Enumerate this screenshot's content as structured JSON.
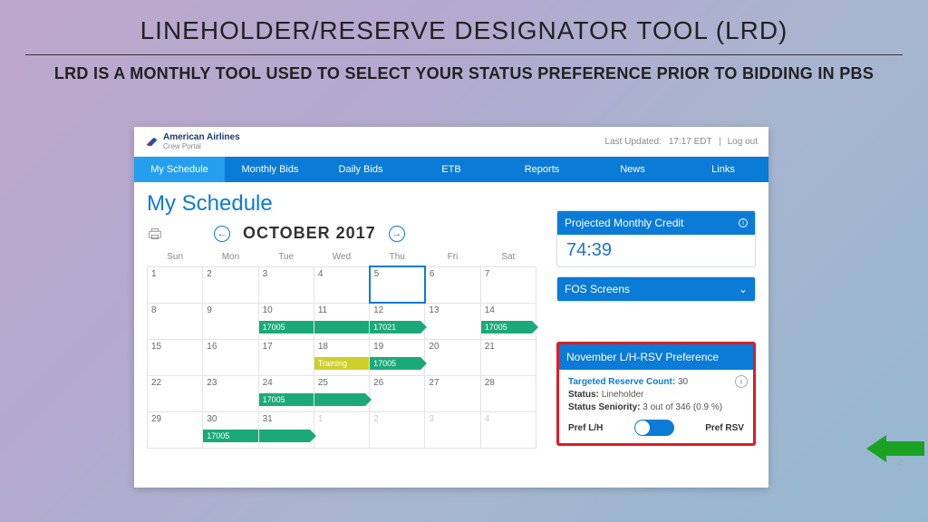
{
  "slide": {
    "title": "LINEHOLDER/RESERVE DESIGNATOR TOOL (LRD)",
    "subtitle": "LRD IS A MONTHLY TOOL USED TO SELECT YOUR STATUS PREFERENCE PRIOR TO BIDDING IN PBS",
    "page_number": "2"
  },
  "portal": {
    "brand_line1": "American Airlines",
    "brand_line2": "Crew Portal",
    "last_updated_label": "Last Updated:",
    "last_updated_value": "17:17 EDT",
    "logout": "Log out",
    "nav": [
      "My Schedule",
      "Monthly Bids",
      "Daily Bids",
      "ETB",
      "Reports",
      "News",
      "Links"
    ],
    "page_title": "My Schedule",
    "month_label": "OCTOBER 2017",
    "day_headers": [
      "Sun",
      "Mon",
      "Tue",
      "Wed",
      "Thu",
      "Fri",
      "Sat"
    ],
    "weeks": [
      [
        {
          "n": "1"
        },
        {
          "n": "2"
        },
        {
          "n": "3"
        },
        {
          "n": "4"
        },
        {
          "n": "5",
          "sel": true
        },
        {
          "n": "6"
        },
        {
          "n": "7"
        }
      ],
      [
        {
          "n": "8"
        },
        {
          "n": "9"
        },
        {
          "n": "10",
          "pill": "17005",
          "pilltype": "full"
        },
        {
          "n": "11",
          "pill": " ",
          "pilltype": "full"
        },
        {
          "n": "12",
          "pill": "17021",
          "pilltype": "end"
        },
        {
          "n": "13"
        },
        {
          "n": "14",
          "pill": "17005",
          "pilltype": "end"
        }
      ],
      [
        {
          "n": "15"
        },
        {
          "n": "16"
        },
        {
          "n": "17"
        },
        {
          "n": "18",
          "pill": "Training",
          "pilltype": "train full"
        },
        {
          "n": "19",
          "pill": "17005",
          "pilltype": "end"
        },
        {
          "n": "20"
        },
        {
          "n": "21"
        }
      ],
      [
        {
          "n": "22"
        },
        {
          "n": "23"
        },
        {
          "n": "24",
          "pill": "17005",
          "pilltype": "full"
        },
        {
          "n": "25",
          "pill": " ",
          "pilltype": "end"
        },
        {
          "n": "26"
        },
        {
          "n": "27"
        },
        {
          "n": "28"
        }
      ],
      [
        {
          "n": "29"
        },
        {
          "n": "30",
          "pill": "17005",
          "pilltype": "full"
        },
        {
          "n": "31",
          "pill": " ",
          "pilltype": "end"
        },
        {
          "n": "1",
          "dim": true
        },
        {
          "n": "2",
          "dim": true
        },
        {
          "n": "3",
          "dim": true
        },
        {
          "n": "4",
          "dim": true
        }
      ]
    ],
    "credit": {
      "title": "Projected Monthly Credit",
      "value": "74:39"
    },
    "fos": {
      "title": "FOS Screens"
    },
    "pref": {
      "title": "November L/H-RSV Preference",
      "reserve_label": "Targeted Reserve Count:",
      "reserve_value": "30",
      "status_label": "Status:",
      "status_value": "Lineholder",
      "seniority_label": "Status Seniority:",
      "seniority_value": "3 out of 346 (0.9 %)",
      "toggle_left": "Pref L/H",
      "toggle_right": "Pref RSV"
    }
  }
}
